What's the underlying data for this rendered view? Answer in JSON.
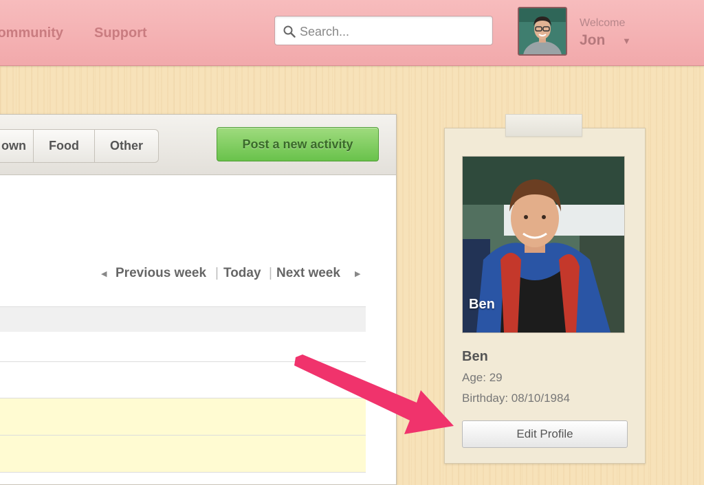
{
  "header": {
    "nav": [
      {
        "label": "Community"
      },
      {
        "label": "Support"
      }
    ],
    "search": {
      "placeholder": "Search..."
    },
    "user": {
      "welcome": "Welcome",
      "name": "Jon"
    }
  },
  "main": {
    "tabs": [
      {
        "label": "own"
      },
      {
        "label": "Food"
      },
      {
        "label": "Other"
      }
    ],
    "post_button": "Post a new activity",
    "week_nav": {
      "previous": "Previous week",
      "today": "Today",
      "next": "Next week",
      "separator": "|"
    }
  },
  "profile": {
    "photo_caption": "Ben",
    "name": "Ben",
    "age": "Age: 29",
    "birthday": "Birthday: 08/10/1984",
    "edit_button": "Edit Profile"
  },
  "colors": {
    "header": "#f2a9ab",
    "accent_green": "#69c24b",
    "annotation_arrow": "#f0336c",
    "highlight_row": "#fffbd2"
  }
}
